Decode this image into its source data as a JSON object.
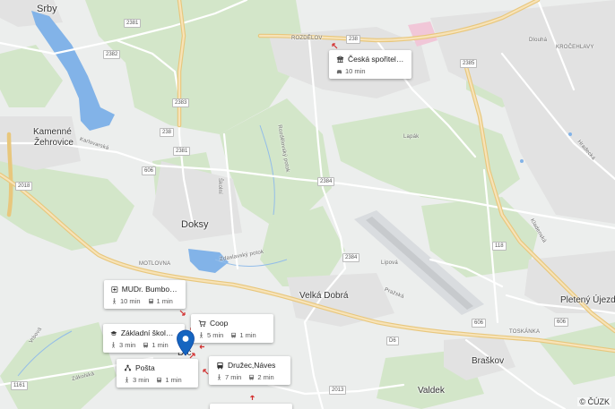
{
  "places": {
    "srby": "Srby",
    "kamenne": "Kamenné",
    "zehrovice": "Žehrovice",
    "doksy": "Doksy",
    "velka_dobra": "Velká Dobrá",
    "pletny_ujezd": "Pletený Újezd",
    "braskov": "Braškov",
    "valdek": "Valdek",
    "drc": "Drc"
  },
  "roads": {
    "r2381": "2381",
    "r2382": "2382",
    "r238a": "238",
    "r2383": "2383",
    "r238b": "238",
    "r2381b": "2381",
    "r606": "606",
    "r2018": "2018",
    "r2384a": "2384",
    "r2384b": "2384",
    "r118": "118",
    "r2385": "2385",
    "r238c": "238",
    "r606b": "606",
    "r606c": "606",
    "r6": "D6",
    "r1161": "1161",
    "r2013": "2013"
  },
  "street_labels": {
    "rozdelov": "ROZDĚLOV",
    "krocehlavy": "KROČEHLAVY",
    "motlovna": "MOTLOVNA",
    "toskanka": "TOSKÁNKA",
    "lapak": "Lapák",
    "karlovarska": "Karlovarská",
    "prazska": "Pražská",
    "lipova": "Lipová",
    "zdaslavsky": "Zdaslavský potok",
    "rozdelovsky": "Rozdělovský potok",
    "kladenska": "Kladenská",
    "dlouha": "Dlouhá",
    "hradecka": "Hradecká",
    "zakolska": "Zákolská",
    "vrbova": "Vrbová",
    "skolni": "Školní"
  },
  "pois": [
    {
      "id": "sporitelna",
      "icon": "bank-icon",
      "name": "Česká spořitelna",
      "car": "10 min",
      "walk": null,
      "bus": null
    },
    {
      "id": "mudr",
      "icon": "medical-icon",
      "name": "MUDr. Bumbová I...",
      "walk": "10 min",
      "bus": "1 min",
      "car": null
    },
    {
      "id": "coop",
      "icon": "cart-icon",
      "name": "Coop",
      "walk": "5 min",
      "bus": "1 min",
      "car": null
    },
    {
      "id": "skola",
      "icon": "school-icon",
      "name": "Základní škola Dr...",
      "walk": "3 min",
      "bus": "1 min",
      "car": null
    },
    {
      "id": "posta",
      "icon": "post-icon",
      "name": "Pošta",
      "walk": "3 min",
      "bus": "1 min",
      "car": null
    },
    {
      "id": "druzec",
      "icon": "bus-icon",
      "name": "Družec,Náves",
      "walk": "7 min",
      "bus": "2 min",
      "car": null
    }
  ],
  "copyright": "© ČÚZK",
  "colors": {
    "land": "#e9ecef",
    "forest": "#cfe3c4",
    "water": "#7fb0e6",
    "major_road": "#f3d79a",
    "minor_road": "#ffffff",
    "pin": "#1565c0"
  }
}
